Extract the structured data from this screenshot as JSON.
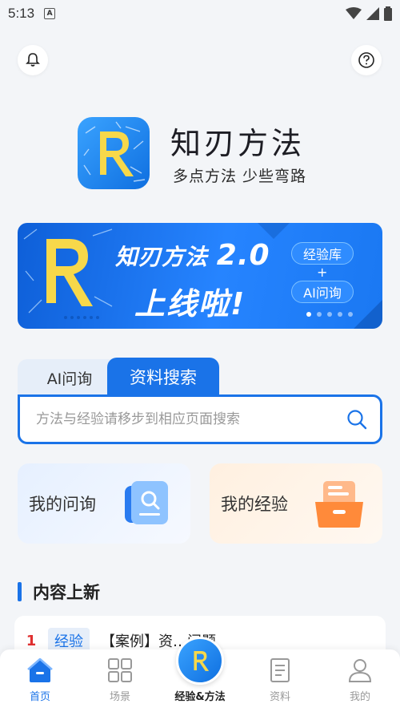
{
  "status_bar": {
    "time": "5:13",
    "notif_letter": "A"
  },
  "brand": {
    "title": "知刃方法",
    "slogan": "多点方法 少些弯路",
    "logo_letter": "R"
  },
  "banner": {
    "title": "知刃方法",
    "version": "2.0",
    "subtitle": "上线啦!",
    "tag1": "经验库",
    "plus": "+",
    "tag2": "AI问询",
    "dots_count": 5,
    "active_dot": 0
  },
  "search": {
    "tabs": [
      {
        "label": "AI问询",
        "active": false
      },
      {
        "label": "资料搜索",
        "active": true
      }
    ],
    "placeholder": "方法与经验请移步到相应页面搜索"
  },
  "cards": {
    "ask_label": "我的问询",
    "exp_label": "我的经验"
  },
  "section": {
    "title": "内容上新"
  },
  "news": [
    {
      "num": "1",
      "chip": "经验",
      "text": "【案例】资…问题"
    }
  ],
  "nav": {
    "home": "首页",
    "scene": "场景",
    "center": "经验&方法",
    "data": "资料",
    "me": "我的"
  },
  "colors": {
    "accent": "#1a73e8",
    "background": "#f3f5f8",
    "banner": "#2684ff",
    "rank": "#e03030"
  }
}
